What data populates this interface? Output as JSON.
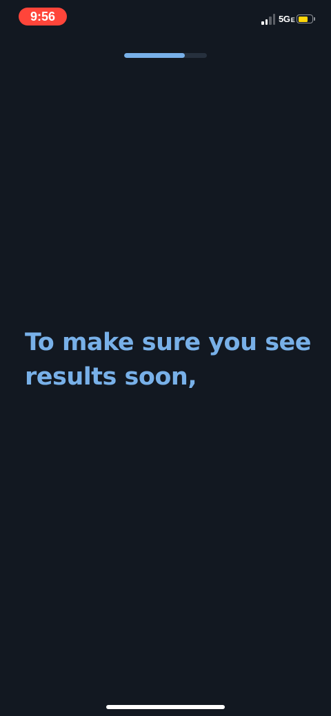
{
  "status_bar": {
    "time": "9:56",
    "network_label": "5G",
    "network_suffix": "E",
    "signal_bars_active": 2,
    "signal_bars_total": 4,
    "battery_level": 0.7,
    "time_pill_color": "#ff453a",
    "battery_color": "#ffd60a",
    "icons": {
      "signal": "cellular-signal-icon",
      "battery": "battery-icon"
    }
  },
  "progress": {
    "fraction": 0.73
  },
  "main": {
    "message": "To make sure you see results soon,"
  },
  "colors": {
    "background": "#121821",
    "accent": "#78b0e8"
  }
}
